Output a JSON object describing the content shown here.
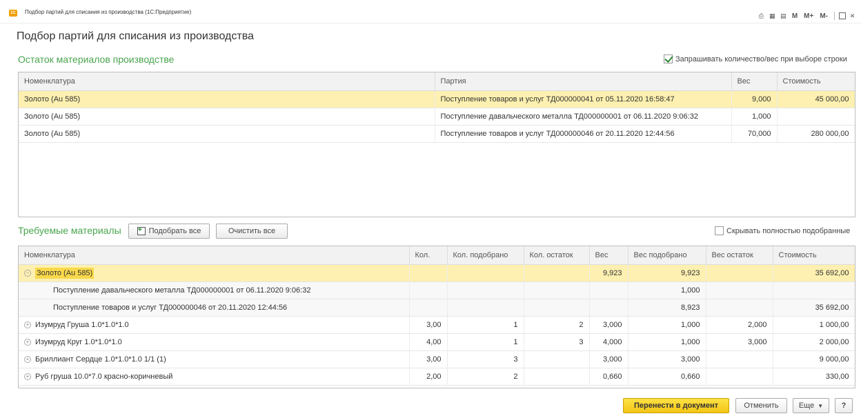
{
  "window": {
    "title": "Подбор партий для списания из производства (1С:Предприятие)",
    "app_icon_text": "1С",
    "m_label": "M",
    "m_plus_label": "M+",
    "m_minus_label": "M-"
  },
  "page_title": "Подбор партий для списания из производства",
  "materials": {
    "title": "Остаток материалов производстве",
    "ask_qty_label": "Запрашивать количество/вес при выборе строки",
    "ask_qty_checked": true,
    "columns": [
      "Номенклатура",
      "Партия",
      "Вес",
      "Стоимость"
    ],
    "rows": [
      {
        "name": "Золото (Au 585)",
        "batch": "Поступление товаров и услуг ТД000000041 от 05.11.2020 16:58:47",
        "weight": "9,000",
        "cost": "45 000,00"
      },
      {
        "name": "Золото (Au 585)",
        "batch": "Поступление давальческого металла ТД000000001 от 06.11.2020 9:06:32",
        "weight": "1,000",
        "cost": ""
      },
      {
        "name": "Золото (Au 585)",
        "batch": "Поступление товаров и услуг ТД000000046 от 20.11.2020 12:44:56",
        "weight": "70,000",
        "cost": "280 000,00"
      }
    ]
  },
  "required": {
    "title": "Требуемые материалы",
    "pick_all_label": "Подобрать все",
    "clear_all_label": "Очистить все",
    "hide_label": "Скрывать полностью подобранные",
    "hide_checked": false,
    "columns": [
      "Номенклатура",
      "Кол.",
      "Кол. подобрано",
      "Кол. остаток",
      "Вес",
      "Вес подобрано",
      "Вес остаток",
      "Стоимость"
    ],
    "rows": [
      {
        "name": "Золото (Au 585)",
        "qty": "",
        "qty_picked": "",
        "qty_left": "",
        "weight": "9,923",
        "weight_picked": "9,923",
        "weight_left": "",
        "cost": "35 692,00"
      },
      {
        "name": "Поступление давальческого металла ТД000000001 от 06.11.2020 9:06:32",
        "qty": "",
        "qty_picked": "",
        "qty_left": "",
        "weight": "",
        "weight_picked": "1,000",
        "weight_left": "",
        "cost": ""
      },
      {
        "name": "Поступление товаров и услуг ТД000000046 от 20.11.2020 12:44:56",
        "qty": "",
        "qty_picked": "",
        "qty_left": "",
        "weight": "",
        "weight_picked": "8,923",
        "weight_left": "",
        "cost": "35 692,00"
      },
      {
        "name": "Изумруд Груша 1.0*1.0*1.0",
        "qty": "3,00",
        "qty_picked": "1",
        "qty_left": "2",
        "weight": "3,000",
        "weight_picked": "1,000",
        "weight_left": "2,000",
        "cost": "1 000,00"
      },
      {
        "name": "Изумруд Круг 1.0*1.0*1.0",
        "qty": "4,00",
        "qty_picked": "1",
        "qty_left": "3",
        "weight": "4,000",
        "weight_picked": "1,000",
        "weight_left": "3,000",
        "cost": "2 000,00"
      },
      {
        "name": "Бриллиант Сердце 1.0*1.0*1.0 1/1 (1)",
        "qty": "3,00",
        "qty_picked": "3",
        "qty_left": "",
        "weight": "3,000",
        "weight_picked": "3,000",
        "weight_left": "",
        "cost": "9 000,00"
      },
      {
        "name": "Руб груша 10.0*7.0 красно-коричневый",
        "qty": "2,00",
        "qty_picked": "2",
        "qty_left": "",
        "weight": "0,660",
        "weight_picked": "0,660",
        "weight_left": "",
        "cost": "330,00"
      }
    ]
  },
  "footer": {
    "transfer_label": "Перенести в документ",
    "cancel_label": "Отменить",
    "more_label": "Еще",
    "help_label": "?"
  },
  "colors": {
    "accent_green": "#4aa44e",
    "selected_row": "#fdf0b0",
    "primary_button": "#f3c515"
  }
}
